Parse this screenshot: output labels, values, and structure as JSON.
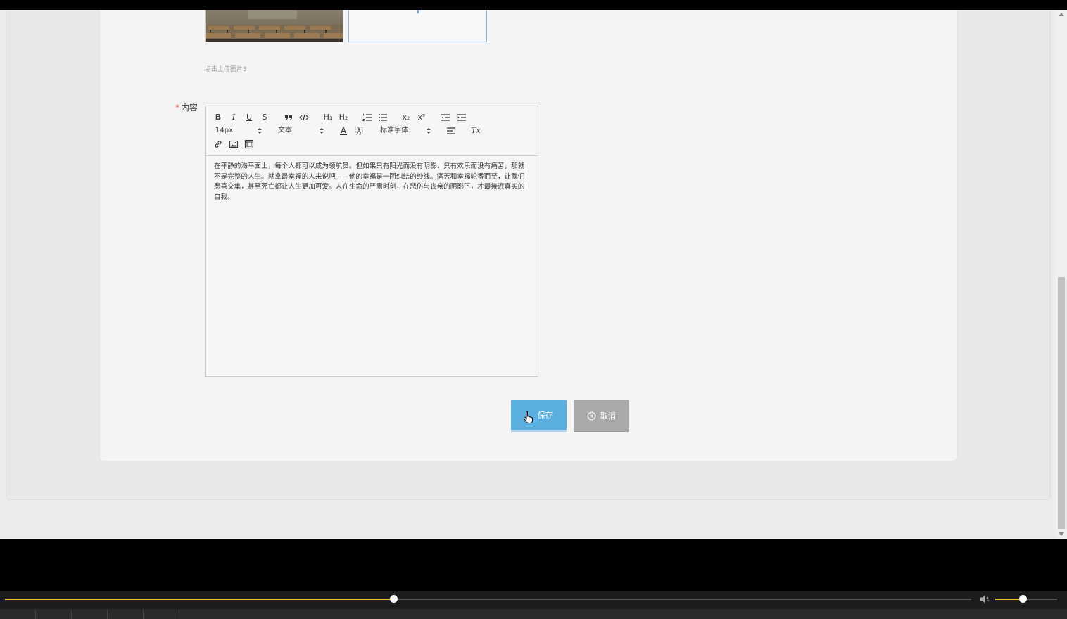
{
  "upload": {
    "hint": "点击上传图片3",
    "thumbnail_icon": "classroom-photo",
    "upload_icon": "plus-icon"
  },
  "content_field": {
    "required_mark": "*",
    "label": "内容"
  },
  "editor": {
    "toolbar": {
      "bold": "B",
      "italic": "I",
      "underline": "U",
      "strike": "S",
      "h1": "H₁",
      "h2": "H₂",
      "sub": "x₂",
      "sup": "x²",
      "clean": "Tx",
      "size_value": "14px",
      "header_value": "文本",
      "font_value": "标准字体"
    },
    "text": "在平静的海平面上，每个人都可以成为领航员。但如果只有阳光而没有阴影，只有欢乐而没有痛苦，那就不是完整的人生。就拿最幸福的人来说吧——他的幸福是一团纠结的纱线。痛苦和幸福轮番而至，让我们悲喜交集，甚至死亡都让人生更加可爱。人在生命的严肃时刻，在悲伤与丧亲的阴影下，才最接近真实的自我。"
  },
  "actions": {
    "save_label": "保存",
    "cancel_label": "取消",
    "save_color": "#5aaee0",
    "cancel_color": "#a9a9a9"
  },
  "player": {
    "progress_fraction": 0.402,
    "volume_fraction": 0.44,
    "accent_color": "#e6c228"
  }
}
